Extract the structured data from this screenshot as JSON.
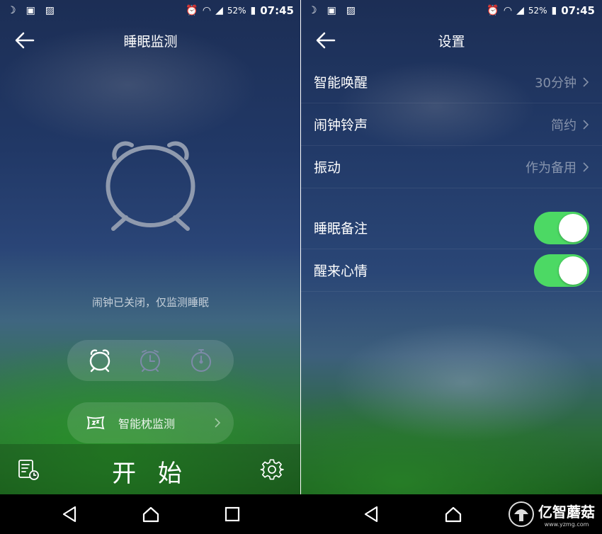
{
  "status": {
    "battery_pct": "52%",
    "time": "07:45"
  },
  "left": {
    "title": "睡眠监测",
    "notice": "闹钟已关闭，仅监测睡眠",
    "pillow_label": "智能枕监测",
    "start_label": "开 始"
  },
  "right": {
    "title": "设置",
    "rows": [
      {
        "name": "智能唤醒",
        "value": "30分钟"
      },
      {
        "name": "闹钟铃声",
        "value": "简约"
      },
      {
        "name": "振动",
        "value": "作为备用"
      }
    ],
    "toggles": [
      {
        "name": "睡眠备注",
        "on": true
      },
      {
        "name": "醒来心情",
        "on": true
      }
    ]
  },
  "brand": {
    "name": "亿智蘑菇",
    "url": "www.yzmg.com"
  },
  "colors": {
    "toggle_on": "#4cd964",
    "accent_green": "#1e6a20"
  }
}
